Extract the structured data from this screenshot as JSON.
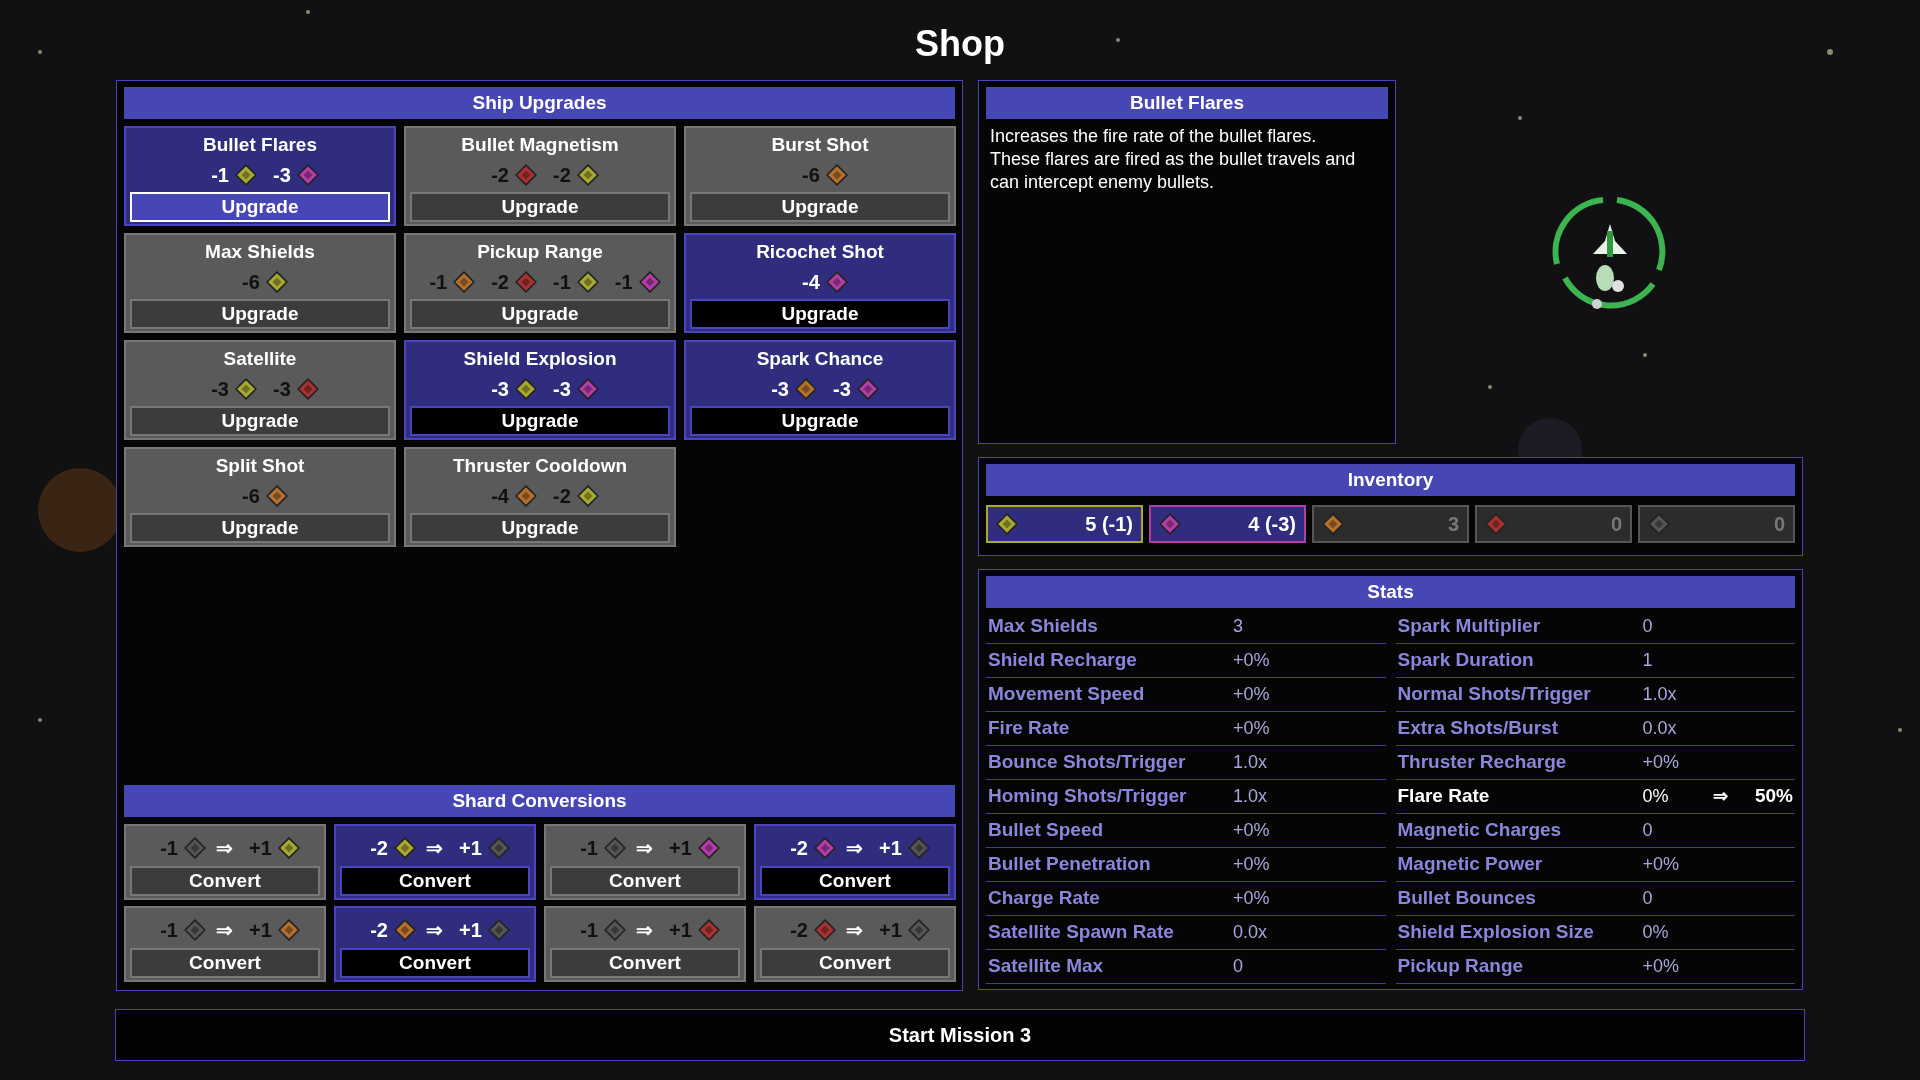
{
  "title": "Shop",
  "upgrades": {
    "title": "Ship Upgrades",
    "items": [
      {
        "name": "Bullet Flares",
        "affordable": true,
        "selected": true,
        "button": "Upgrade",
        "costs": [
          {
            "amount": "-1",
            "color": "#a8a832"
          },
          {
            "amount": "-3",
            "color": "#b43ca8"
          }
        ]
      },
      {
        "name": "Bullet Magnetism",
        "affordable": false,
        "selected": false,
        "button": "Upgrade",
        "costs": [
          {
            "amount": "-2",
            "color": "#a83232"
          },
          {
            "amount": "-2",
            "color": "#a8a832"
          }
        ]
      },
      {
        "name": "Burst Shot",
        "affordable": false,
        "selected": false,
        "button": "Upgrade",
        "costs": [
          {
            "amount": "-6",
            "color": "#b4702d"
          }
        ]
      },
      {
        "name": "Max Shields",
        "affordable": false,
        "selected": false,
        "button": "Upgrade",
        "costs": [
          {
            "amount": "-6",
            "color": "#a8a832"
          }
        ]
      },
      {
        "name": "Pickup Range",
        "affordable": false,
        "selected": false,
        "button": "Upgrade",
        "costs": [
          {
            "amount": "-1",
            "color": "#b4702d"
          },
          {
            "amount": "-2",
            "color": "#a83232"
          },
          {
            "amount": "-1",
            "color": "#a8a832"
          },
          {
            "amount": "-1",
            "color": "#b43ca8"
          }
        ]
      },
      {
        "name": "Ricochet Shot",
        "affordable": true,
        "selected": false,
        "button": "Upgrade",
        "costs": [
          {
            "amount": "-4",
            "color": "#b43ca8"
          }
        ]
      },
      {
        "name": "Satellite",
        "affordable": false,
        "selected": false,
        "button": "Upgrade",
        "costs": [
          {
            "amount": "-3",
            "color": "#a8a832"
          },
          {
            "amount": "-3",
            "color": "#a83232"
          }
        ]
      },
      {
        "name": "Shield Explosion",
        "affordable": true,
        "selected": false,
        "button": "Upgrade",
        "costs": [
          {
            "amount": "-3",
            "color": "#a8a832"
          },
          {
            "amount": "-3",
            "color": "#b43ca8"
          }
        ]
      },
      {
        "name": "Spark Chance",
        "affordable": true,
        "selected": false,
        "button": "Upgrade",
        "costs": [
          {
            "amount": "-3",
            "color": "#b4702d"
          },
          {
            "amount": "-3",
            "color": "#b43ca8"
          }
        ]
      },
      {
        "name": "Split Shot",
        "affordable": false,
        "selected": false,
        "button": "Upgrade",
        "costs": [
          {
            "amount": "-6",
            "color": "#b4702d"
          }
        ]
      },
      {
        "name": "Thruster Cooldown",
        "affordable": false,
        "selected": false,
        "button": "Upgrade",
        "costs": [
          {
            "amount": "-4",
            "color": "#b4702d"
          },
          {
            "amount": "-2",
            "color": "#a8a832"
          }
        ]
      }
    ]
  },
  "conversions": {
    "title": "Shard Conversions",
    "items": [
      {
        "from": {
          "amount": "-1",
          "color": "#555555"
        },
        "arrow": "⇒",
        "to": {
          "amount": "+1",
          "color": "#a8a832"
        },
        "affordable": false,
        "button": "Convert"
      },
      {
        "from": {
          "amount": "-2",
          "color": "#a8a832"
        },
        "arrow": "⇒",
        "to": {
          "amount": "+1",
          "color": "#555555"
        },
        "affordable": true,
        "button": "Convert"
      },
      {
        "from": {
          "amount": "-1",
          "color": "#555555"
        },
        "arrow": "⇒",
        "to": {
          "amount": "+1",
          "color": "#b43ca8"
        },
        "affordable": false,
        "button": "Convert"
      },
      {
        "from": {
          "amount": "-2",
          "color": "#b43ca8"
        },
        "arrow": "⇒",
        "to": {
          "amount": "+1",
          "color": "#555555"
        },
        "affordable": true,
        "button": "Convert"
      },
      {
        "from": {
          "amount": "-1",
          "color": "#555555"
        },
        "arrow": "⇒",
        "to": {
          "amount": "+1",
          "color": "#b4702d"
        },
        "affordable": false,
        "button": "Convert"
      },
      {
        "from": {
          "amount": "-2",
          "color": "#b4702d"
        },
        "arrow": "⇒",
        "to": {
          "amount": "+1",
          "color": "#555555"
        },
        "affordable": true,
        "button": "Convert"
      },
      {
        "from": {
          "amount": "-1",
          "color": "#555555"
        },
        "arrow": "⇒",
        "to": {
          "amount": "+1",
          "color": "#a83232"
        },
        "affordable": false,
        "button": "Convert"
      },
      {
        "from": {
          "amount": "-2",
          "color": "#a83232"
        },
        "arrow": "⇒",
        "to": {
          "amount": "+1",
          "color": "#555555"
        },
        "affordable": false,
        "button": "Convert"
      }
    ]
  },
  "details": {
    "title": "Bullet Flares",
    "description": "Increases the fire rate of the bullet flares. These flares are fired as the bullet travels and can intercept enemy bullets."
  },
  "inventory": {
    "title": "Inventory",
    "items": [
      {
        "color": "#a8a832",
        "count": "5 (-1)",
        "spending": true
      },
      {
        "color": "#b43ca8",
        "count": "4 (-3)",
        "spending": true
      },
      {
        "color": "#b4702d",
        "count": "3",
        "spending": false
      },
      {
        "color": "#a83232",
        "count": "0",
        "spending": false
      },
      {
        "color": "#555555",
        "count": "0",
        "spending": false
      }
    ]
  },
  "stats": {
    "title": "Stats",
    "columns": [
      [
        {
          "label": "Max Shields",
          "value": "3"
        },
        {
          "label": "Shield Recharge",
          "value": "+0%"
        },
        {
          "label": "Movement Speed",
          "value": "+0%"
        },
        {
          "label": "Fire Rate",
          "value": "+0%"
        },
        {
          "label": "Bounce Shots/Trigger",
          "value": "1.0x"
        },
        {
          "label": "Homing Shots/Trigger",
          "value": "1.0x"
        },
        {
          "label": "Bullet Speed",
          "value": "+0%"
        },
        {
          "label": "Bullet Penetration",
          "value": "+0%"
        },
        {
          "label": "Charge Rate",
          "value": "+0%"
        },
        {
          "label": "Satellite Spawn Rate",
          "value": "0.0x"
        },
        {
          "label": "Satellite Max",
          "value": "0"
        }
      ],
      [
        {
          "label": "Spark Multiplier",
          "value": "0"
        },
        {
          "label": "Spark Duration",
          "value": "1"
        },
        {
          "label": "Normal Shots/Trigger",
          "value": "1.0x"
        },
        {
          "label": "Extra Shots/Burst",
          "value": "0.0x"
        },
        {
          "label": "Thruster Recharge",
          "value": "+0%"
        },
        {
          "label": "Flare Rate",
          "value": "0%",
          "arrow": "⇒",
          "new_value": "50%"
        },
        {
          "label": "Magnetic Charges",
          "value": "0"
        },
        {
          "label": "Magnetic Power",
          "value": "+0%"
        },
        {
          "label": "Bullet Bounces",
          "value": "0"
        },
        {
          "label": "Shield Explosion Size",
          "value": "0%"
        },
        {
          "label": "Pickup Range",
          "value": "+0%"
        }
      ]
    ]
  },
  "start_button": "Start Mission 3"
}
